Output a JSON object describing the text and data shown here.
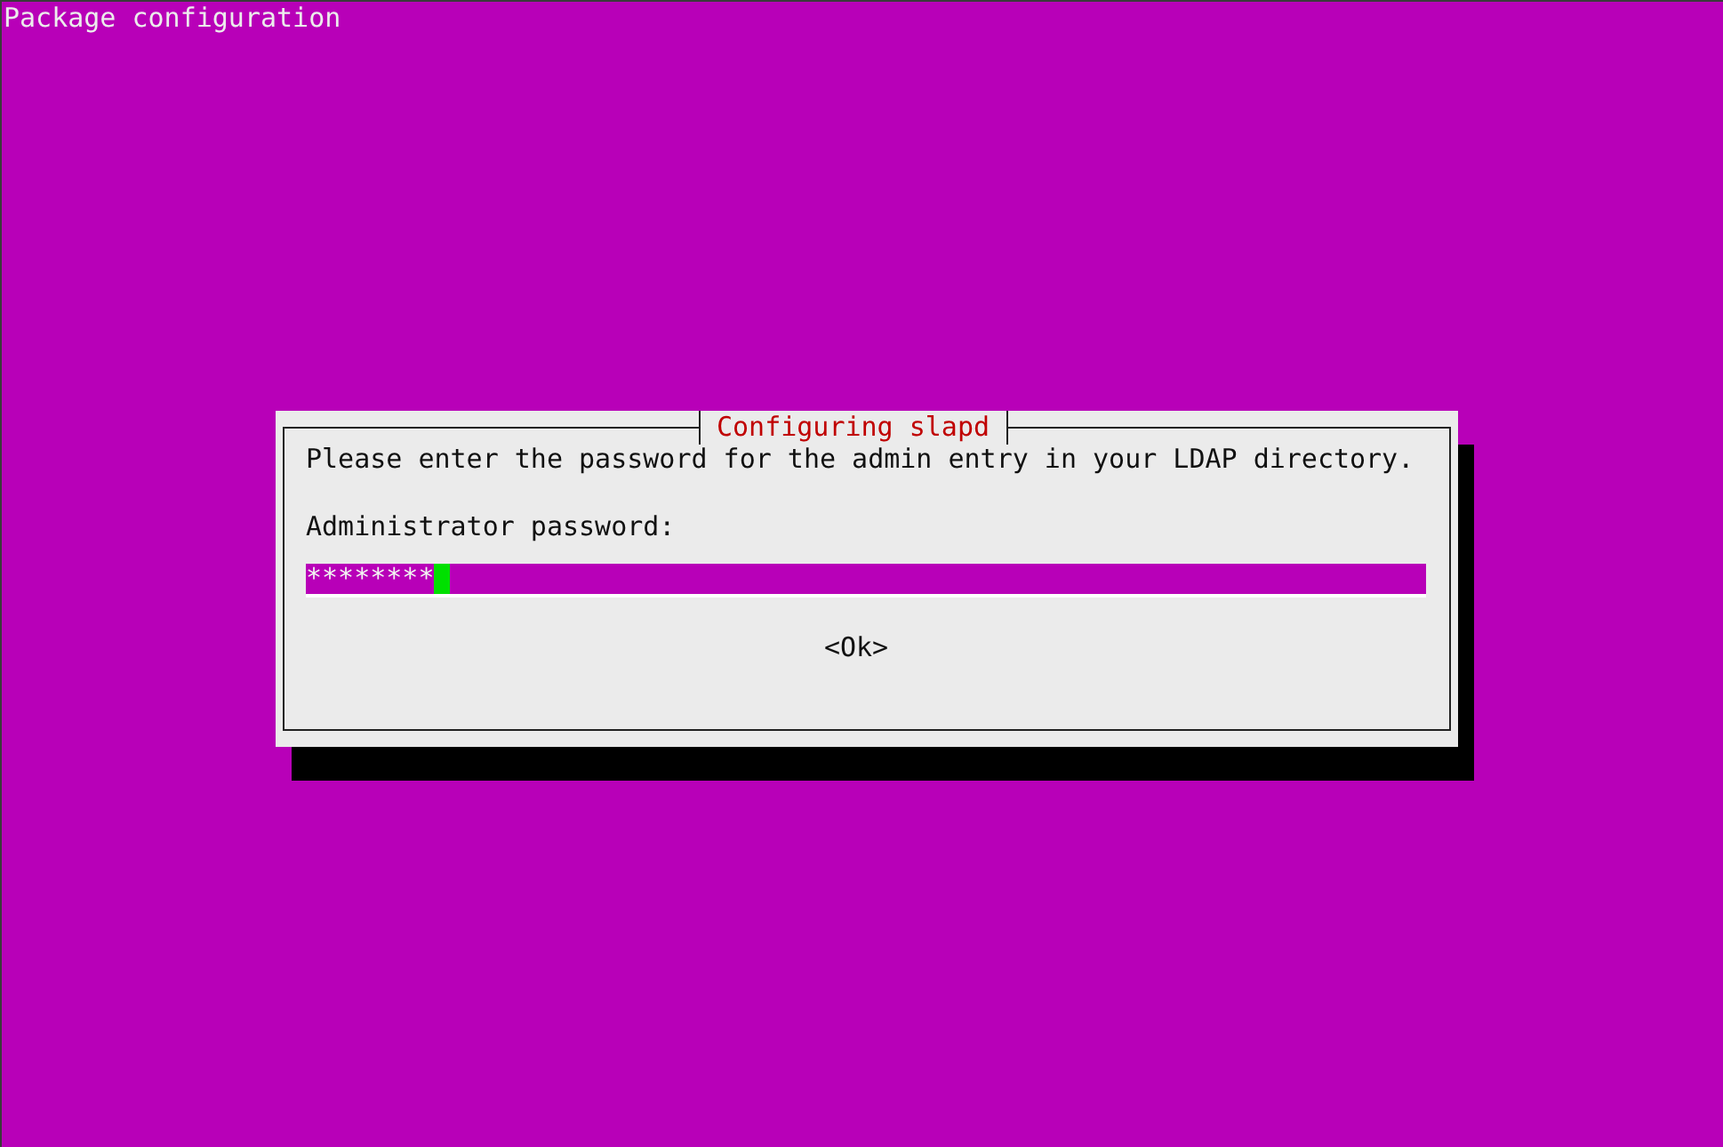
{
  "screen": {
    "title": "Package configuration"
  },
  "dialog": {
    "title": "Configuring slapd",
    "message": "Please enter the password for the admin entry in your LDAP directory.",
    "field": {
      "label": "Administrator password:",
      "value": "********",
      "focused": true
    },
    "buttons": [
      {
        "label": "<Ok>",
        "selected": false
      }
    ]
  }
}
